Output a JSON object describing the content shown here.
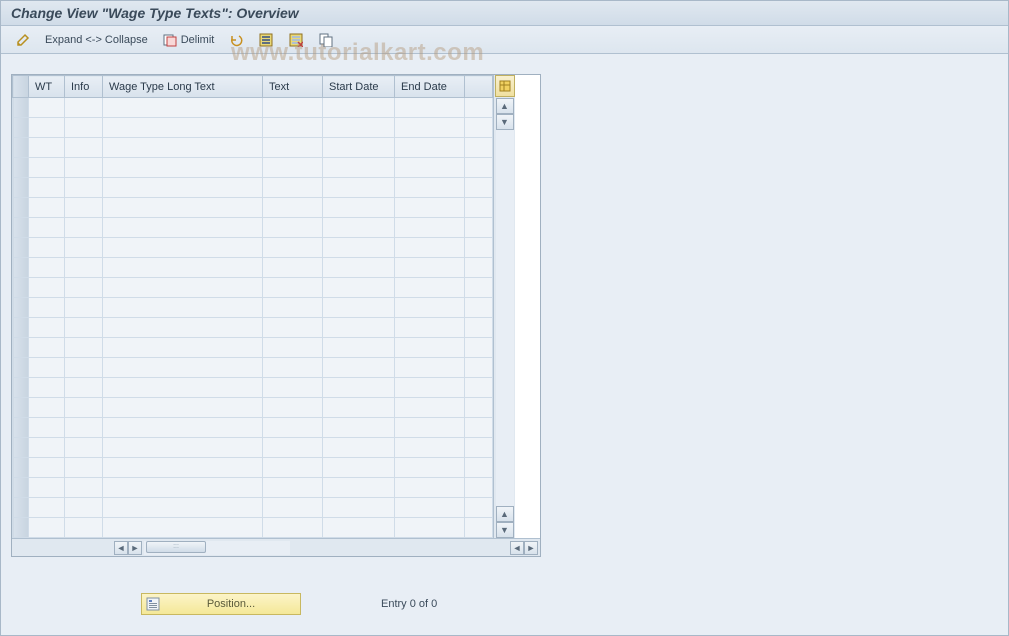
{
  "title": "Change View \"Wage Type Texts\": Overview",
  "toolbar": {
    "expand_collapse": "Expand <-> Collapse",
    "delimit": "Delimit"
  },
  "table": {
    "columns": [
      "WT",
      "Info",
      "Wage Type Long Text",
      "Text",
      "Start Date",
      "End Date"
    ],
    "row_count": 22
  },
  "footer": {
    "position_label": "Position...",
    "entry_text": "Entry 0 of 0"
  },
  "watermark": "www.tutorialkart.com"
}
